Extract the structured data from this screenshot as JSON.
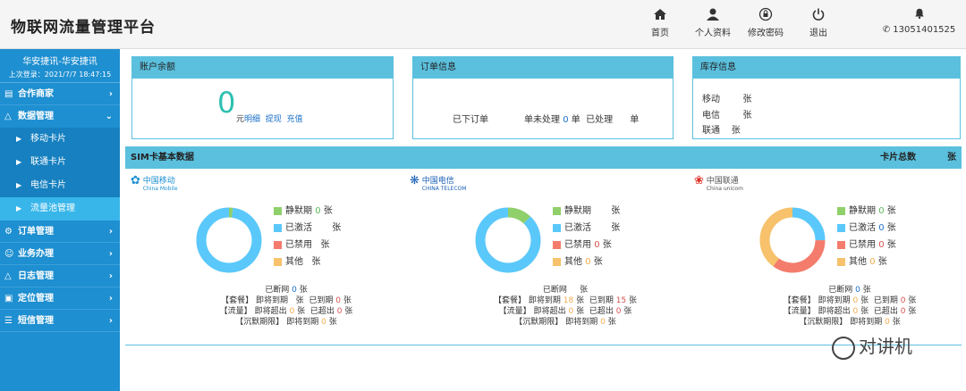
{
  "app": {
    "title": "物联网流量管理平台"
  },
  "nav": [
    {
      "label": "首页",
      "icon": "home-icon"
    },
    {
      "label": "个人资料",
      "icon": "user-icon"
    },
    {
      "label": "修改密码",
      "icon": "lock-icon"
    },
    {
      "label": "退出",
      "icon": "power-icon"
    }
  ],
  "phone": {
    "number": "13051401525"
  },
  "user": {
    "name": "华安捷讯-华安捷讯",
    "last_login": "上次登录：2021/7/7 18:47:15"
  },
  "menu": {
    "partners": "合作商家",
    "data_mgmt": "数据管理",
    "sub": [
      "移动卡片",
      "联通卡片",
      "电信卡片",
      "流量池管理"
    ],
    "orders": "订单管理",
    "business": "业务办理",
    "logs": "日志管理",
    "location": "定位管理",
    "sms": "短信管理"
  },
  "balance": {
    "title": "账户余额",
    "value": "0",
    "unit": "元",
    "detail": "明细",
    "withdraw": "提现",
    "recharge": "充值"
  },
  "orders": {
    "title": "订单信息",
    "placed": "已下订单",
    "unprocessed": "单未处理",
    "count": "0",
    "unit": "单",
    "processed": "已处理",
    "processed_unit": "单"
  },
  "stock": {
    "title": "库存信息",
    "mobile": "移动",
    "telecom": "电信",
    "unicom": "联通",
    "unit": "张"
  },
  "sim": {
    "title": "SIM卡基本数据",
    "total_label": "卡片总数",
    "total_unit": "张"
  },
  "carriers": [
    {
      "name_cn": "中国移动",
      "name_en": "China Mobile",
      "legend": [
        {
          "label": "静默期",
          "value": "0",
          "unit": "张"
        },
        {
          "label": "已激活",
          "value": "",
          "unit": "张"
        },
        {
          "label": "已禁用",
          "value": "",
          "unit": "张"
        },
        {
          "label": "其他",
          "value": "",
          "unit": "张"
        }
      ],
      "donut": [
        0.02,
        0.98,
        0,
        0
      ],
      "disconnected": "已断网",
      "disconnected_val": "0",
      "unit": "张",
      "pkg": "【套餐】",
      "flow": "【流量】",
      "silent": "【沉默期限】",
      "expiring": "即将到期",
      "expired": "已到期",
      "exceed_soon": "即将超出",
      "exceeded": "已超出",
      "pkg_expiring": "",
      "pkg_expired": "0",
      "flow_exceed_soon": "0",
      "flow_exceeded": "0",
      "silent_expiring": "0"
    },
    {
      "name_cn": "中国电信",
      "name_en": "CHINA TELECOM",
      "legend": [
        {
          "label": "静默期",
          "value": "",
          "unit": "张"
        },
        {
          "label": "已激活",
          "value": "",
          "unit": "张"
        },
        {
          "label": "已禁用",
          "value": "0",
          "unit": "张"
        },
        {
          "label": "其他",
          "value": "0",
          "unit": "张"
        }
      ],
      "donut": [
        0.12,
        0.88,
        0,
        0
      ],
      "disconnected": "已断网",
      "disconnected_val": "",
      "unit": "张",
      "pkg": "【套餐】",
      "flow": "【流量】",
      "silent": "【沉默期限】",
      "expiring": "即将到期",
      "expired": "已到期",
      "exceed_soon": "即将超出",
      "exceeded": "已超出",
      "pkg_expiring": "18",
      "pkg_expired": "15",
      "flow_exceed_soon": "0",
      "flow_exceeded": "0",
      "silent_expiring": "0"
    },
    {
      "name_cn": "中国联通",
      "name_en": "China unicom",
      "legend": [
        {
          "label": "静默期",
          "value": "0",
          "unit": "张"
        },
        {
          "label": "已激活",
          "value": "0",
          "unit": "张"
        },
        {
          "label": "已禁用",
          "value": "0",
          "unit": "张"
        },
        {
          "label": "其他",
          "value": "0",
          "unit": "张"
        }
      ],
      "donut": [
        0,
        0.25,
        0.35,
        0.4
      ],
      "disconnected": "已断网",
      "disconnected_val": "0",
      "unit": "张",
      "pkg": "【套餐】",
      "flow": "【流量】",
      "silent": "【沉默期限】",
      "expiring": "即将到期",
      "expired": "已到期",
      "exceed_soon": "即将超出",
      "exceeded": "已超出",
      "pkg_expiring": "0",
      "pkg_expired": "0",
      "flow_exceed_soon": "0",
      "flow_exceeded": "0",
      "silent_expiring": "0"
    }
  ],
  "colors": {
    "silent": "#8fd06a",
    "active": "#5ac8fa",
    "disabled": "#f47c6c",
    "other": "#f7c26b",
    "ring_bg": "#e8e8e8"
  },
  "watermark": "对讲机"
}
